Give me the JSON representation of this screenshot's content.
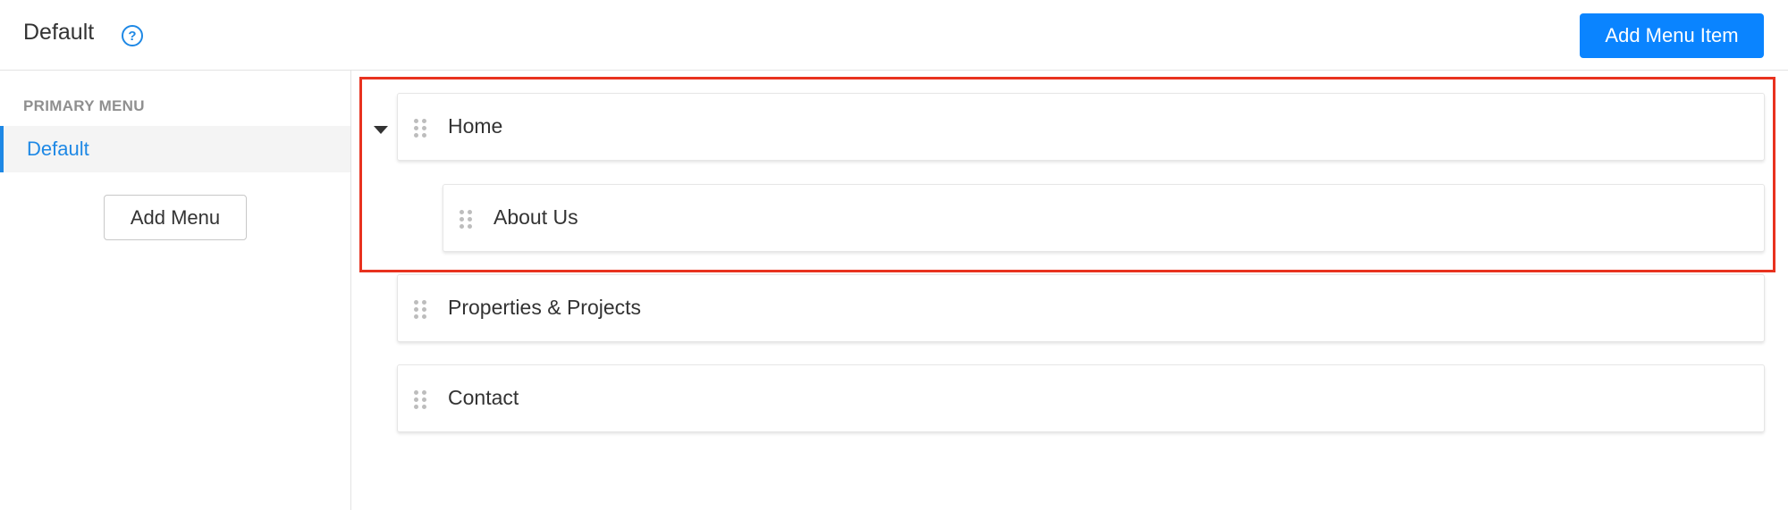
{
  "header": {
    "title": "Default",
    "help_icon": "help-circle-icon",
    "add_menu_item_label": "Add Menu Item"
  },
  "sidebar": {
    "section_label": "PRIMARY MENU",
    "items": [
      {
        "label": "Default",
        "active": true
      }
    ],
    "add_menu_label": "Add Menu"
  },
  "menu_items": [
    {
      "label": "Home",
      "level": 0,
      "expanded": true,
      "icon": "drag-handle-icon"
    },
    {
      "label": "About Us",
      "level": 1,
      "icon": "drag-handle-icon"
    },
    {
      "label": "Properties & Projects",
      "level": 0,
      "icon": "drag-handle-icon"
    },
    {
      "label": "Contact",
      "level": 0,
      "icon": "drag-handle-icon"
    }
  ],
  "colors": {
    "accent": "#1e88e5",
    "primary_button": "#0a84ff",
    "highlight_border": "#e8321f"
  }
}
